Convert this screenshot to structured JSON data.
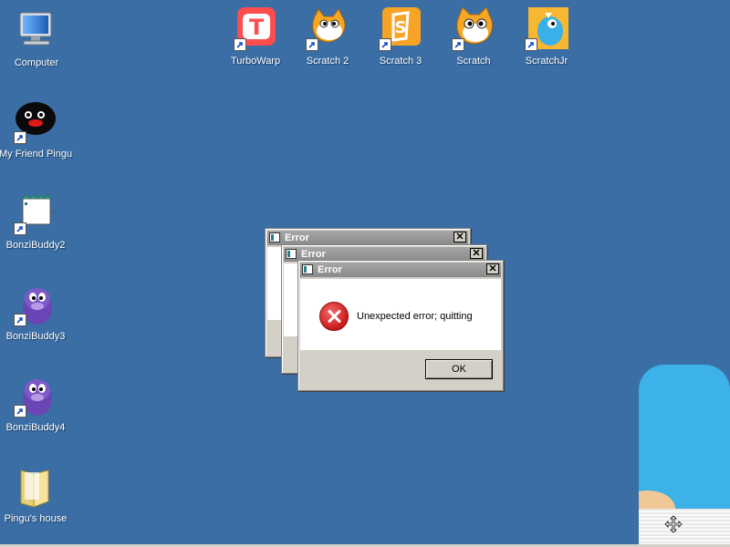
{
  "desktop": {
    "icons_left": [
      {
        "label": "Computer"
      },
      {
        "label": "My Friend Pingu"
      },
      {
        "label": "BonziBuddy2"
      },
      {
        "label": "BonziBuddy3"
      },
      {
        "label": "BonziBuddy4"
      },
      {
        "label": "Pingu's house"
      }
    ],
    "icons_top": [
      {
        "label": "TurboWarp"
      },
      {
        "label": "Scratch 2"
      },
      {
        "label": "Scratch 3"
      },
      {
        "label": "Scratch"
      },
      {
        "label": "ScratchJr"
      }
    ],
    "background_color": "#3a6ea5"
  },
  "dialogs": [
    {
      "title": "Error"
    },
    {
      "title": "Error"
    },
    {
      "title": "Error",
      "message": "Unexpected error; quitting",
      "ok_label": "OK",
      "close_label": "✕"
    }
  ]
}
